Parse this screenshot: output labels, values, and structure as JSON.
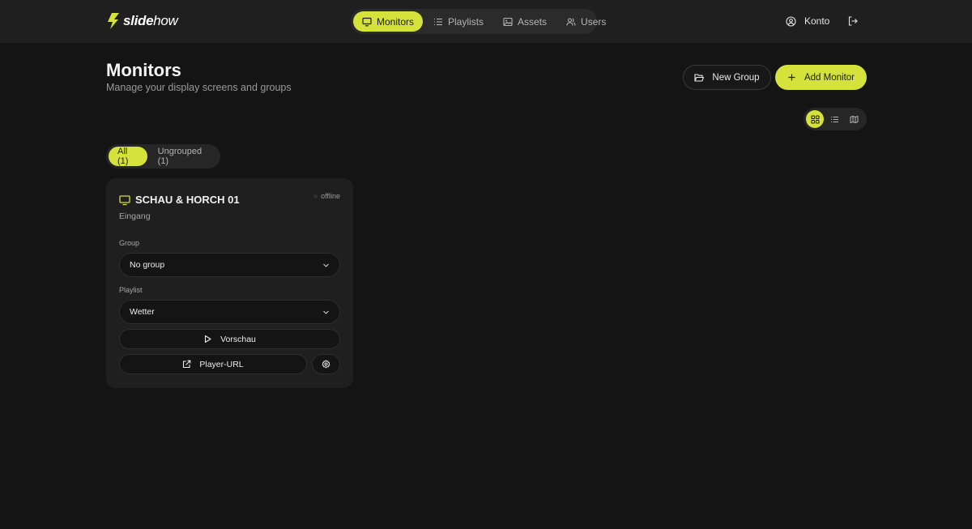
{
  "app": {
    "logo_bold": "slide",
    "logo_italic": "how",
    "brand_color": "#d4e23b"
  },
  "nav": {
    "items": [
      {
        "label": "Monitors",
        "icon": "monitor-icon",
        "active": true
      },
      {
        "label": "Playlists",
        "icon": "list-icon",
        "active": false
      },
      {
        "label": "Assets",
        "icon": "image-icon",
        "active": false
      },
      {
        "label": "Users",
        "icon": "users-icon",
        "active": false
      }
    ]
  },
  "account": {
    "label": "Konto",
    "icon": "user-circle-icon",
    "logout_icon": "logout-icon"
  },
  "page": {
    "title": "Monitors",
    "subtitle": "Manage your display screens and groups",
    "new_group_label": "New Group",
    "add_monitor_label": "Add Monitor",
    "view_modes": [
      "grid",
      "list",
      "map"
    ],
    "active_view": "grid"
  },
  "filters": {
    "tabs": [
      {
        "label": "All (1)",
        "active": true
      },
      {
        "label": "Ungrouped (1)",
        "active": false
      }
    ]
  },
  "monitors": [
    {
      "name": "SCHAU & HORCH 01",
      "status": "offline",
      "location": "Eingang",
      "group_label": "Group",
      "group_value": "No group",
      "playlist_label": "Playlist",
      "playlist_value": "Wetter",
      "preview_label": "Vorschau",
      "player_url_label": "Player-URL"
    }
  ]
}
